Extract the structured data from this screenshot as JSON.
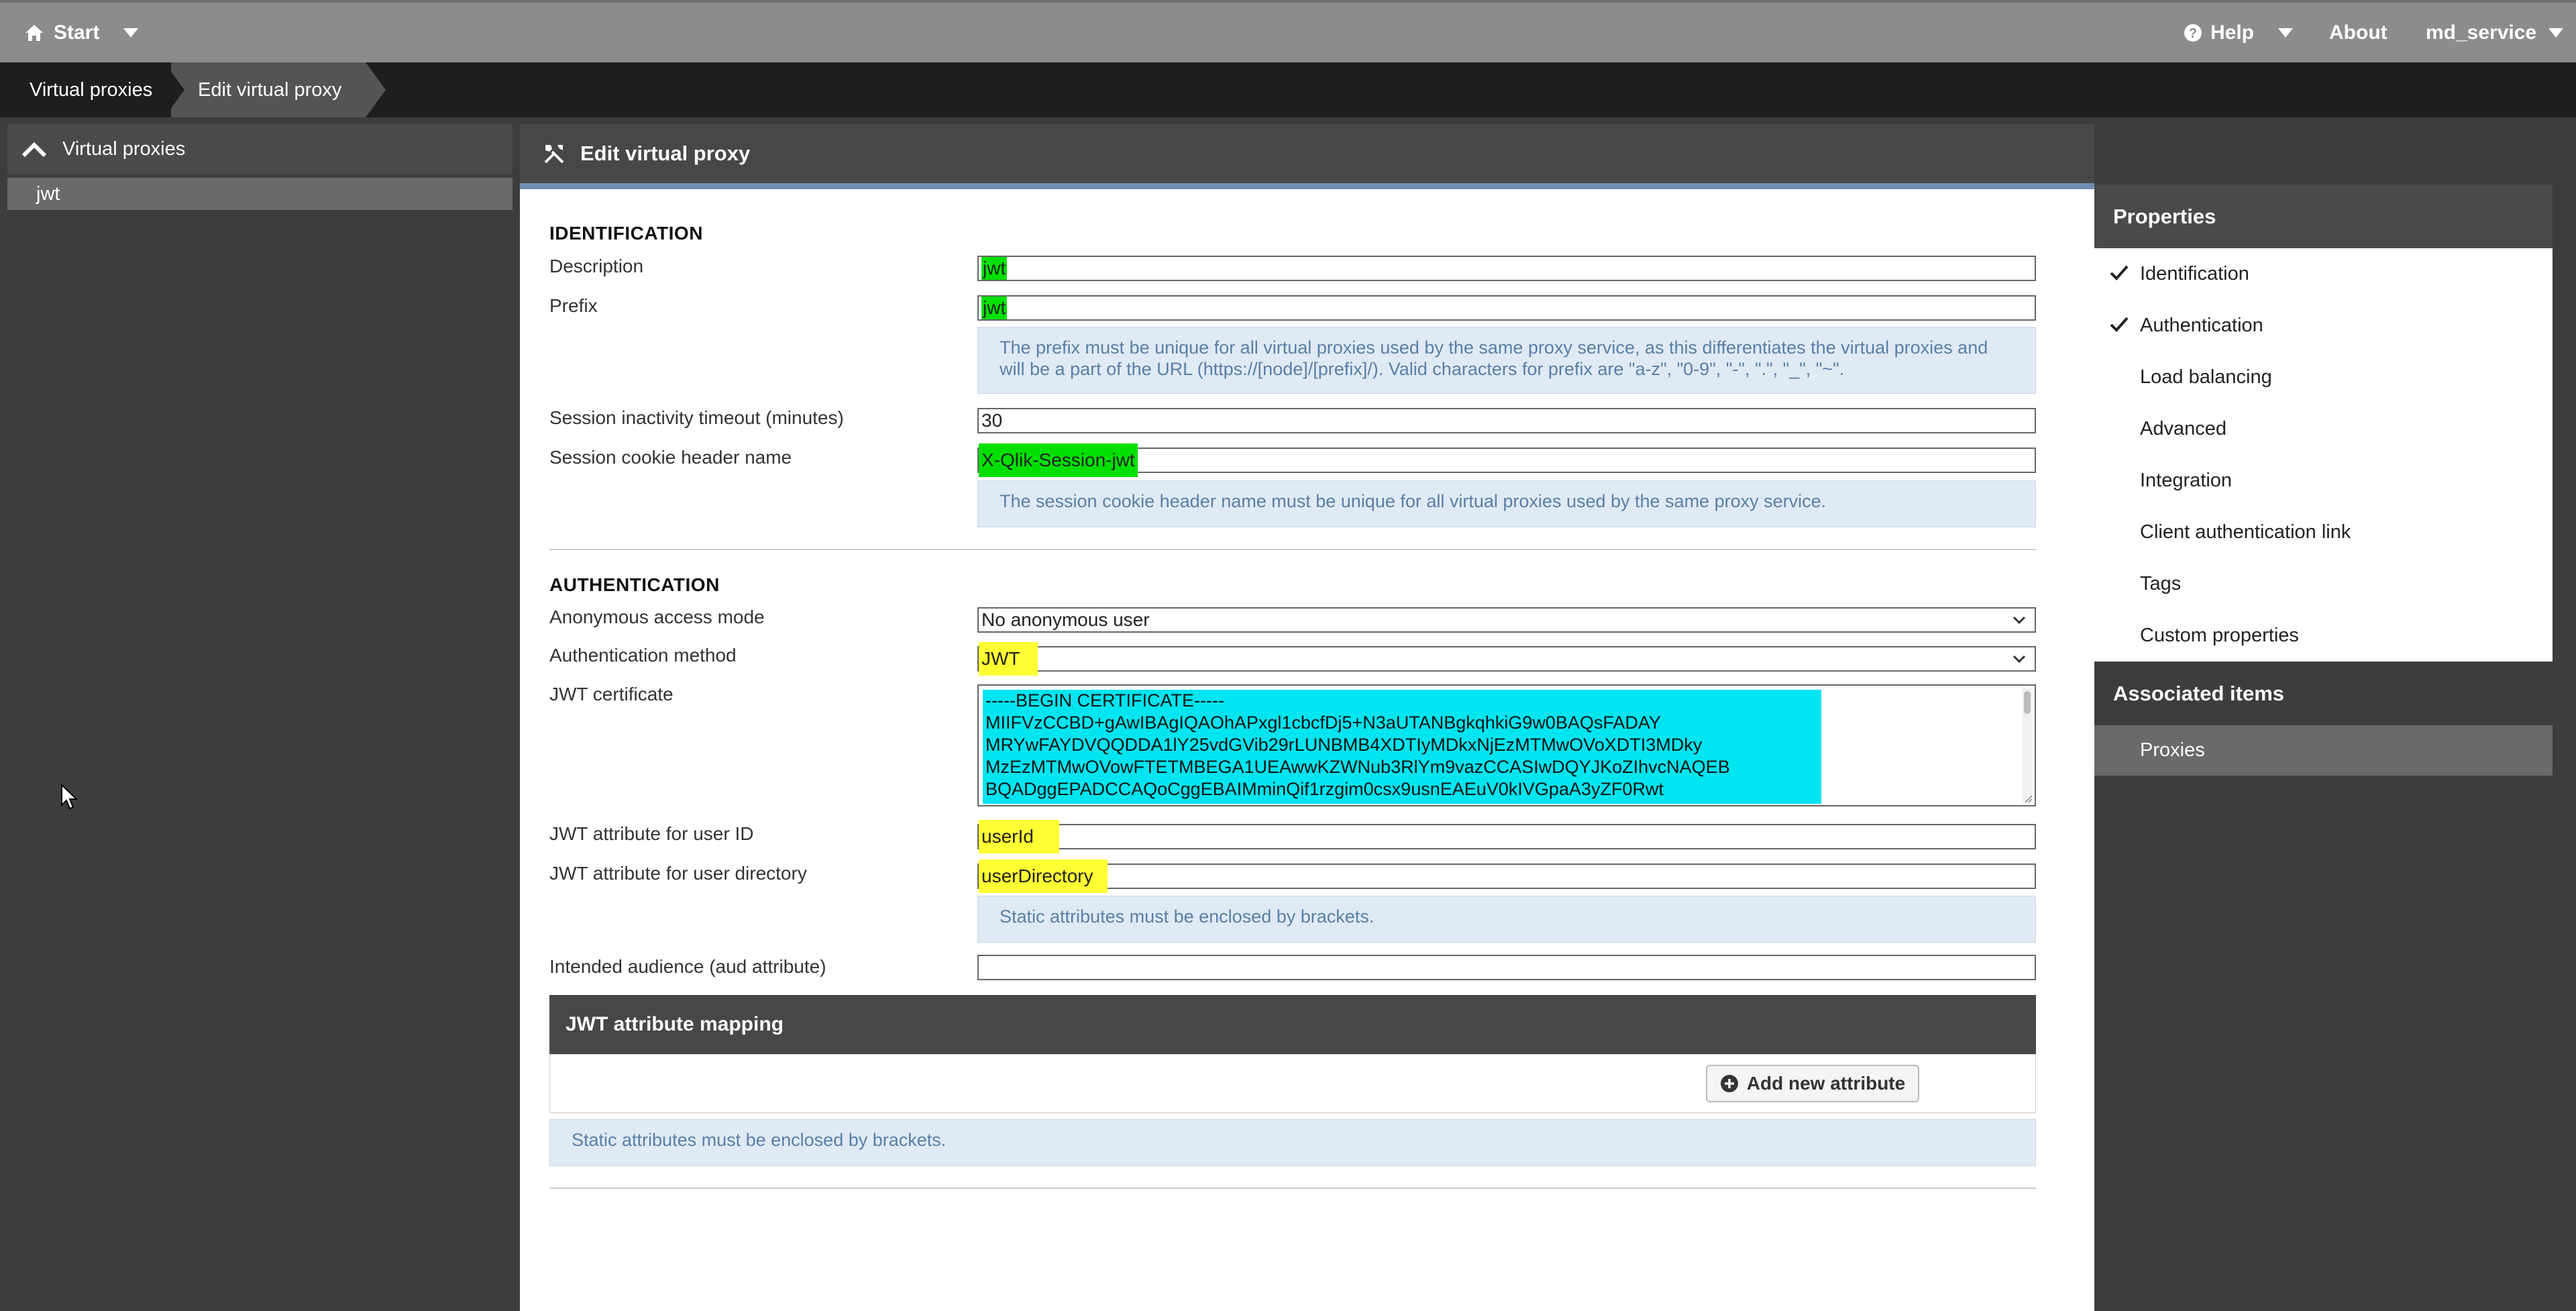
{
  "topbar": {
    "start_label": "Start",
    "help_label": "Help",
    "about_label": "About",
    "user_label": "md_service"
  },
  "breadcrumb": {
    "items": [
      "Virtual proxies",
      "Edit virtual proxy"
    ]
  },
  "sidebar": {
    "header": "Virtual proxies",
    "items": [
      "jwt"
    ]
  },
  "main": {
    "title": "Edit virtual proxy",
    "identification": {
      "section": "IDENTIFICATION",
      "description_label": "Description",
      "description_value": "jwt",
      "prefix_label": "Prefix",
      "prefix_value": "jwt",
      "prefix_info": "The prefix must be unique for all virtual proxies used by the same proxy service, as this differentiates the virtual proxies and will be a part of the URL (https://[node]/[prefix]/). Valid characters for prefix are \"a-z\", \"0-9\", \"-\", \".\", \"_\", \"~\".",
      "timeout_label": "Session inactivity timeout (minutes)",
      "timeout_value": "30",
      "cookie_label": "Session cookie header name",
      "cookie_value": "X-Qlik-Session-jwt",
      "cookie_info": "The session cookie header name must be unique for all virtual proxies used by the same proxy service."
    },
    "authentication": {
      "section": "AUTHENTICATION",
      "anon_label": "Anonymous access mode",
      "anon_value": "No anonymous user",
      "method_label": "Authentication method",
      "method_value": "JWT",
      "cert_label": "JWT certificate",
      "cert_value": "-----BEGIN CERTIFICATE-----\nMIIFVzCCBD+gAwIBAgIQAOhAPxgl1cbcfDj5+N3aUTANBgkqhkiG9w0BAQsFADAY\nMRYwFAYDVQQDDA1lY25vdGVib29rLUNBMB4XDTIyMDkxNjEzMTMwOVoXDTI3MDky\nMzEzMTMwOVowFTETMBEGA1UEAwwKZWNub3RlYm9vazCCASIwDQYJKoZIhvcNAQEB\nBQADggEPADCCAQoCggEBAIMminQif1rzgim0csx9usnEAEuV0kIVGpaA3yZF0Rwt",
      "userid_label": "JWT attribute for user ID",
      "userid_value": "userId",
      "userdir_label": "JWT attribute for user directory",
      "userdir_value": "userDirectory",
      "static_info": "Static attributes must be enclosed by brackets.",
      "aud_label": "Intended audience (aud attribute)",
      "aud_value": ""
    },
    "mapping": {
      "title": "JWT attribute mapping",
      "add_label": "Add new attribute",
      "info": "Static attributes must be enclosed by brackets."
    }
  },
  "properties": {
    "header": "Properties",
    "items": [
      {
        "label": "Identification",
        "checked": true
      },
      {
        "label": "Authentication",
        "checked": true
      },
      {
        "label": "Load balancing",
        "checked": false
      },
      {
        "label": "Advanced",
        "checked": false
      },
      {
        "label": "Integration",
        "checked": false
      },
      {
        "label": "Client authentication link",
        "checked": false
      },
      {
        "label": "Tags",
        "checked": false
      },
      {
        "label": "Custom properties",
        "checked": false
      }
    ],
    "associated_header": "Associated items",
    "associated_items": [
      "Proxies"
    ]
  },
  "colors": {
    "highlight_green": "#00e000",
    "highlight_yellow": "#ffff33",
    "highlight_cyan": "#00e5ef",
    "info_text": "#5a7fa6",
    "accent": "#6e8fb5"
  }
}
